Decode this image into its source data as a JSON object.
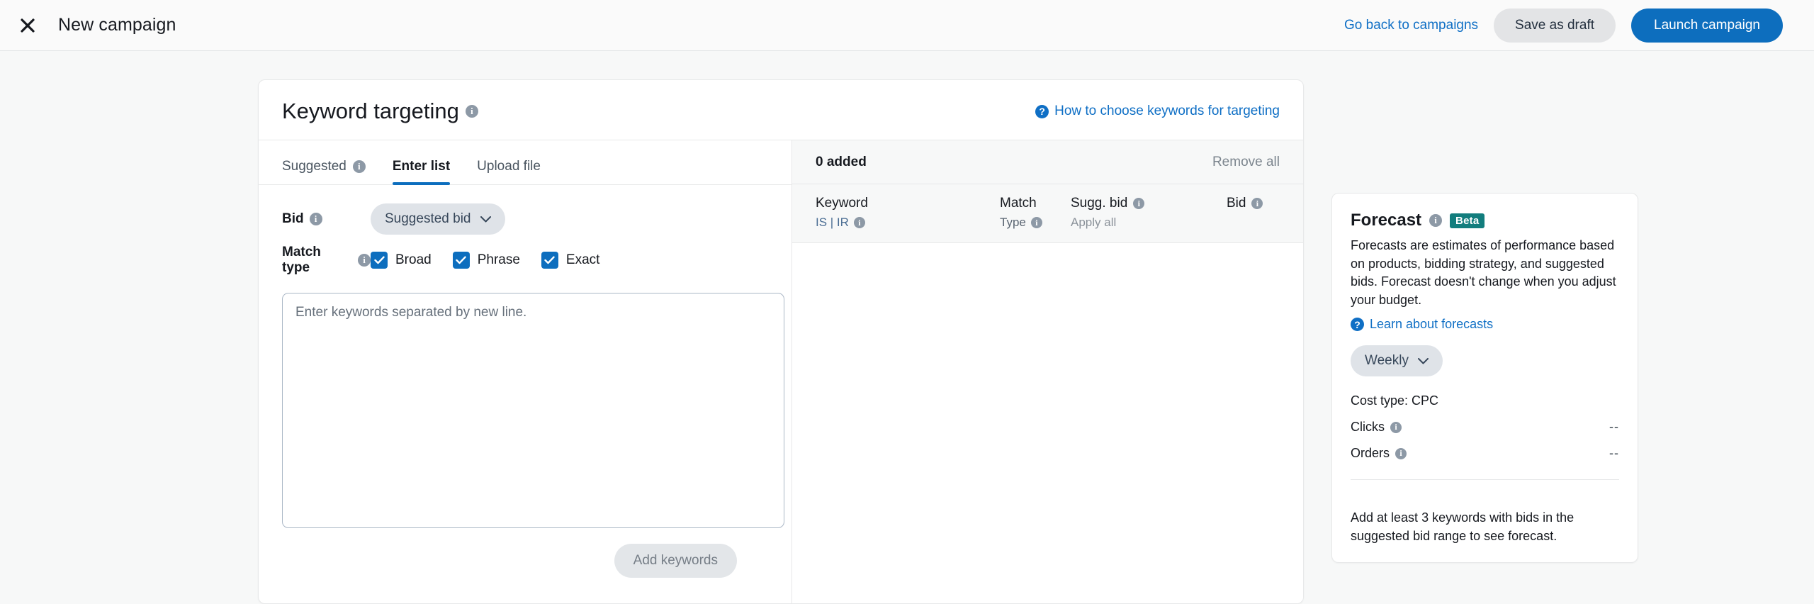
{
  "topbar": {
    "close_icon": "close-icon",
    "title": "New campaign",
    "go_back_link": "Go back to campaigns",
    "save_draft_label": "Save as draft",
    "launch_label": "Launch campaign"
  },
  "keyword_card": {
    "title": "Keyword targeting",
    "help_link": "How to choose keywords for targeting",
    "tabs": [
      {
        "label": "Suggested",
        "active": false,
        "has_info": true
      },
      {
        "label": "Enter list",
        "active": true,
        "has_info": false
      },
      {
        "label": "Upload file",
        "active": false,
        "has_info": false
      }
    ],
    "bid_label": "Bid",
    "bid_value": "Suggested bid",
    "match_type_label": "Match type",
    "match_types": [
      {
        "label": "Broad",
        "checked": true
      },
      {
        "label": "Phrase",
        "checked": true
      },
      {
        "label": "Exact",
        "checked": true
      }
    ],
    "keywords_placeholder": "Enter keywords separated by new line.",
    "keywords_value": "",
    "add_keywords_label": "Add keywords",
    "added_count": "0 added",
    "remove_all_label": "Remove all",
    "columns": {
      "keyword": "Keyword",
      "keyword_sub": "IS | IR",
      "match": "Match",
      "match_sub": "Type",
      "sugg_bid": "Sugg. bid",
      "apply_all": "Apply all",
      "bid": "Bid"
    }
  },
  "forecast": {
    "title": "Forecast",
    "badge": "Beta",
    "description": "Forecasts are estimates of performance based on products, bidding strategy, and suggested bids. Forecast doesn't change when you adjust your budget.",
    "learn_link": "Learn about forecasts",
    "period_value": "Weekly",
    "cost_type": "Cost type: CPC",
    "metrics": [
      {
        "label": "Clicks",
        "value": "--"
      },
      {
        "label": "Orders",
        "value": "--"
      }
    ],
    "note": "Add at least 3 keywords with bids in the suggested bid range to see forecast."
  },
  "colors": {
    "accent_blue": "#0d6ebe",
    "link_blue": "#0f6fc5",
    "beta_teal": "#127d7d",
    "page_bg": "#f7f8f8"
  }
}
